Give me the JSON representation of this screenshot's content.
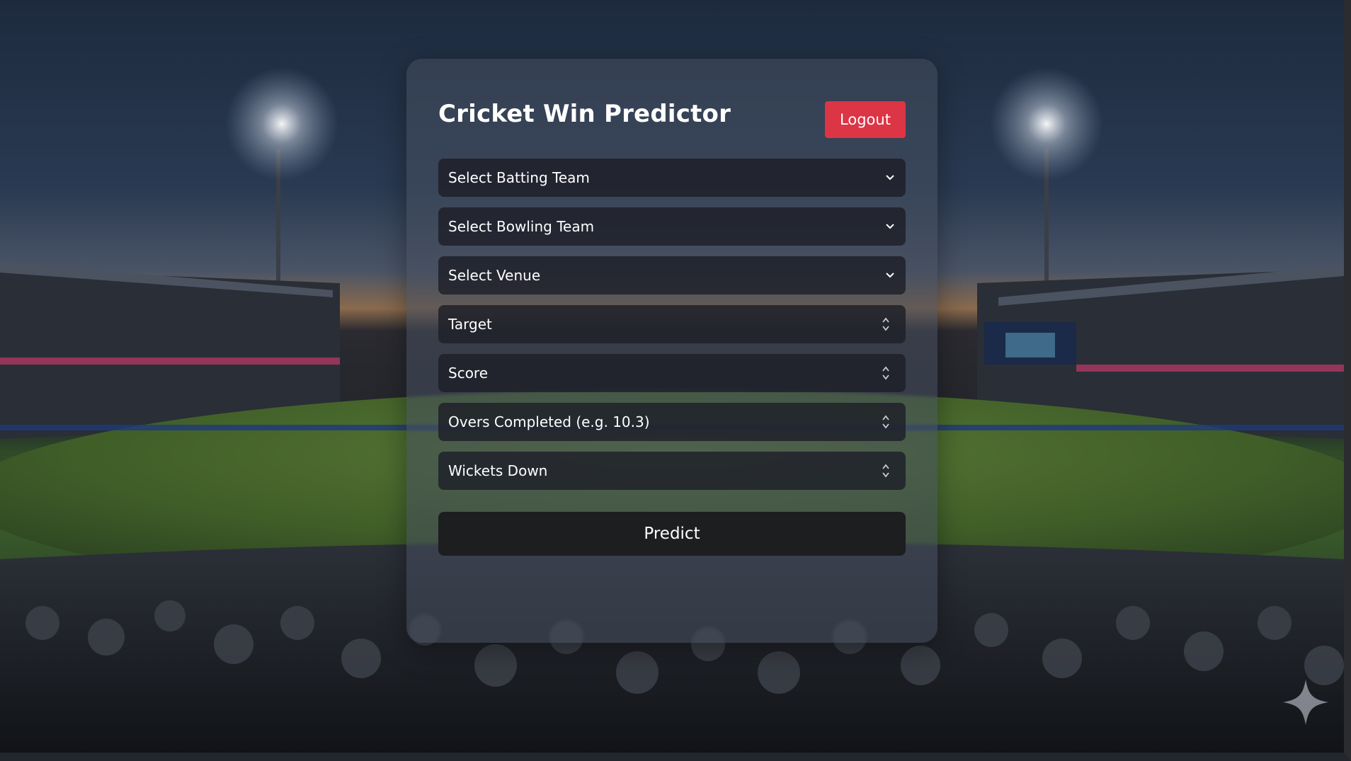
{
  "app": {
    "title": "Cricket Win Predictor",
    "logout_label": "Logout",
    "predict_label": "Predict"
  },
  "form": {
    "batting_team": {
      "placeholder": "Select Batting Team",
      "icon": "chevron-down-icon"
    },
    "bowling_team": {
      "placeholder": "Select Bowling Team",
      "icon": "chevron-down-icon"
    },
    "venue": {
      "placeholder": "Select Venue",
      "icon": "chevron-down-icon"
    },
    "target": {
      "placeholder": "Target",
      "icon": "spinner-arrows-icon"
    },
    "score": {
      "placeholder": "Score",
      "icon": "spinner-arrows-icon"
    },
    "overs": {
      "placeholder": "Overs Completed (e.g. 10.3)",
      "icon": "spinner-arrows-icon"
    },
    "wickets": {
      "placeholder": "Wickets Down",
      "icon": "spinner-arrows-icon"
    }
  },
  "colors": {
    "logout": "#dc3545",
    "predict": "#1d1e20",
    "field_bg": "#1e2028",
    "card_bg": "#464e5e"
  }
}
